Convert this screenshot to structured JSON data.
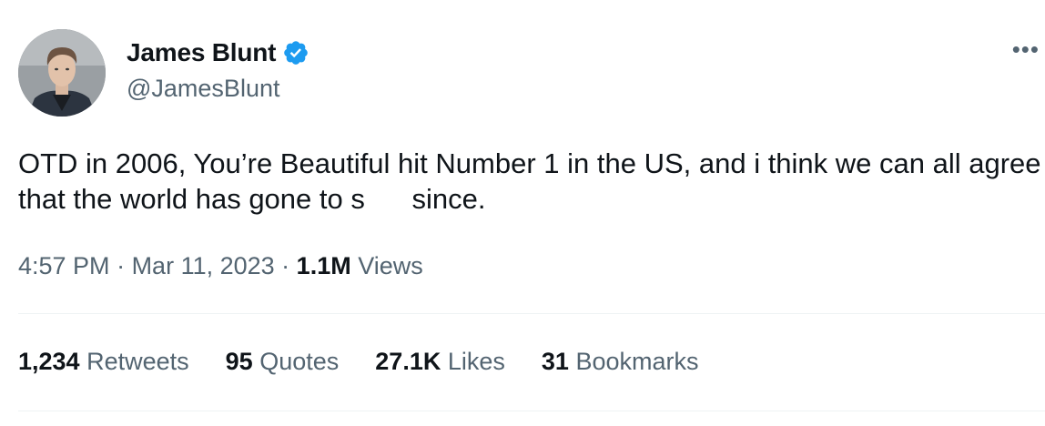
{
  "author": {
    "display_name": "James Blunt",
    "handle": "@JamesBlunt",
    "verified_icon": "verified-badge-icon"
  },
  "more_icon": "more-horizontal-icon",
  "tweet": {
    "text": "OTD in 2006, You’re Beautiful hit Number 1 in the US, and i think we can all agree that the world has gone to s      since."
  },
  "meta": {
    "time": "4:57 PM",
    "separator": " · ",
    "date": "Mar 11, 2023",
    "views_count": "1.1M",
    "views_label": "Views"
  },
  "stats": [
    {
      "count": "1,234",
      "label": "Retweets"
    },
    {
      "count": "95",
      "label": "Quotes"
    },
    {
      "count": "27.1K",
      "label": "Likes"
    },
    {
      "count": "31",
      "label": "Bookmarks"
    }
  ],
  "colors": {
    "verified": "#1d9bf0",
    "text_primary": "#0f1419",
    "text_secondary": "#536471",
    "divider": "#eff3f4"
  }
}
